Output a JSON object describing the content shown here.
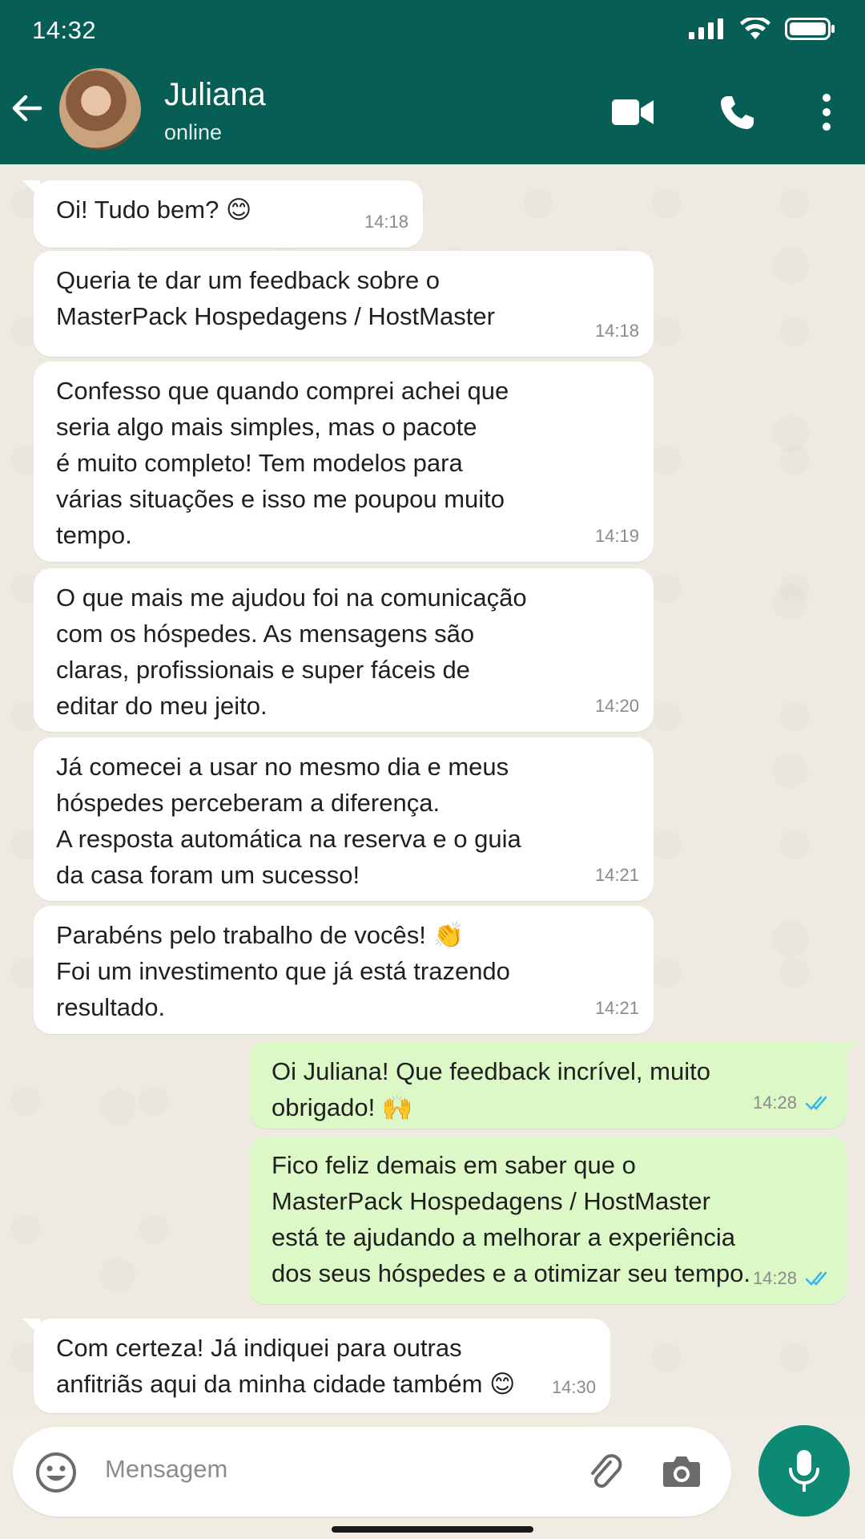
{
  "status_bar": {
    "time": "14:32"
  },
  "header": {
    "contact_name": "Juliana",
    "contact_status": "online"
  },
  "messages": [
    {
      "lines": [
        "Oi! Tudo bem? 😊"
      ],
      "time": "14:18"
    },
    {
      "lines": [
        "Queria te dar um feedback sobre o",
        "MasterPack Hospedagens / HostMaster"
      ],
      "time": "14:18"
    },
    {
      "lines": [
        "Confesso que quando comprei achei que",
        "seria algo mais simples, mas o pacote",
        "é muito completo! Tem modelos para",
        "várias situações e isso me poupou muito",
        "tempo."
      ],
      "time": "14:19"
    },
    {
      "lines": [
        "O que mais me ajudou foi na comunicação",
        "com os hóspedes. As mensagens são",
        "claras, profissionais e super fáceis de",
        "editar do meu jeito."
      ],
      "time": "14:20"
    },
    {
      "lines": [
        "Já comecei a usar no mesmo dia e meus",
        "hóspedes perceberam a diferença.",
        "A resposta automática na reserva e o guia",
        "da casa foram um sucesso!"
      ],
      "time": "14:21"
    },
    {
      "lines": [
        "Parabéns pelo trabalho de vocês! 👏",
        "Foi um investimento que já está trazendo",
        "resultado."
      ],
      "time": "14:21"
    },
    {
      "lines": [
        "Oi Juliana! Que feedback incrível, muito",
        "obrigado! 🙌"
      ],
      "time": "14:28"
    },
    {
      "lines": [
        "Fico feliz demais em saber que o",
        "MasterPack Hospedagens / HostMaster",
        "está te ajudando a melhorar a experiência",
        "dos seus hóspedes e a otimizar seu tempo."
      ],
      "time": "14:28"
    },
    {
      "lines": [
        "Com certeza! Já indiquei para outras",
        "anfitriãs aqui da minha cidade também 😊"
      ],
      "time": "14:30"
    }
  ],
  "composer": {
    "placeholder": "Mensagem"
  },
  "colors": {
    "header": "#075e54",
    "incoming_bubble": "#ffffff",
    "outgoing_bubble": "#dcf8c6",
    "read_ticks": "#34b7f1",
    "mic_button": "#0c8a74"
  },
  "icons": [
    "back-arrow-icon",
    "video-call-icon",
    "phone-icon",
    "more-options-icon",
    "emoji-icon",
    "attach-icon",
    "camera-icon",
    "mic-icon",
    "double-check-icon",
    "signal-icon",
    "wifi-icon",
    "battery-icon"
  ]
}
